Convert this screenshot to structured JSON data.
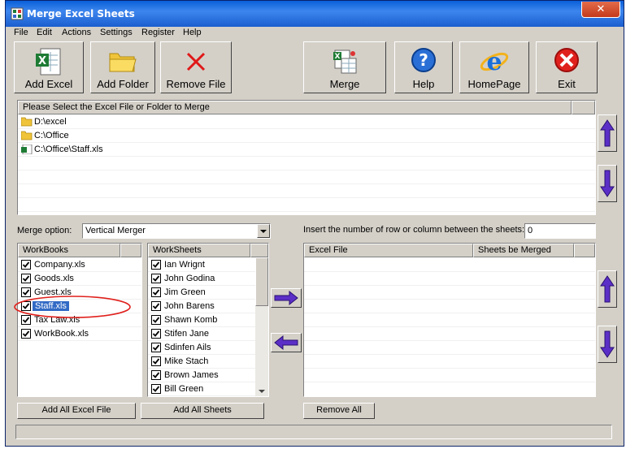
{
  "window": {
    "title": "Merge Excel Sheets",
    "close_label": "✕"
  },
  "menu": {
    "items": [
      "File",
      "Edit",
      "Actions",
      "Settings",
      "Register",
      "Help"
    ]
  },
  "toolbar": {
    "add_excel": "Add Excel",
    "add_folder": "Add Folder",
    "remove_file": "Remove File",
    "merge": "Merge",
    "help": "Help",
    "homepage": "HomePage",
    "exit": "Exit"
  },
  "file_list": {
    "header": "Please Select the Excel File or Folder to Merge",
    "items": [
      {
        "text": "D:\\excel",
        "icon": "folder-icon"
      },
      {
        "text": "C:\\Office",
        "icon": "folder-icon"
      },
      {
        "text": "C:\\Office\\Staff.xls",
        "icon": "excel-file-icon"
      }
    ]
  },
  "merge_option": {
    "label": "Merge option:",
    "value": "Vertical Merger"
  },
  "insert_rows": {
    "label": "Insert the number of row or column between the sheets:",
    "value": "0"
  },
  "workbooks": {
    "header": "WorkBooks",
    "items": [
      "Company.xls",
      "Goods.xls",
      "Guest.xls",
      "Staff.xls",
      "Tax Law.xls",
      "WorkBook.xls"
    ],
    "selected_index": 3
  },
  "worksheets": {
    "header": "WorkSheets",
    "items": [
      "Ian Wrignt",
      "John Godina",
      "Jim Green",
      "John Barens",
      "Shawn Komb",
      "Stifen Jane",
      "Sdinfen Ails",
      "Mike Stach",
      "Brown James",
      "Bill Green"
    ]
  },
  "merged_list": {
    "col1": "Excel File",
    "col2": "Sheets be Merged"
  },
  "buttons": {
    "add_all_excel": "Add All Excel File",
    "add_all_sheets": "Add All Sheets",
    "remove_all": "Remove All"
  },
  "colors": {
    "selection": "#316ac5",
    "arrow": "#5b2fc7",
    "annotation": "#e0201c"
  }
}
